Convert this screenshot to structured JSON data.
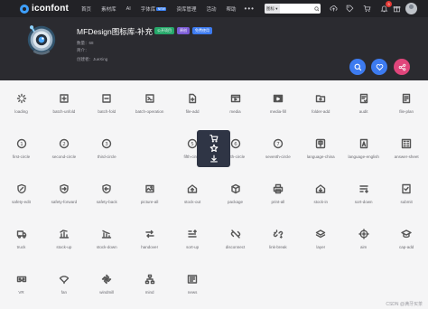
{
  "topnav": {
    "logo_text": "iconfont",
    "menu": [
      {
        "label": "首页",
        "badge": ""
      },
      {
        "label": "素材库",
        "badge": ""
      },
      {
        "label": "AI",
        "badge": ""
      },
      {
        "label": "字体库",
        "badge": "NEW"
      },
      {
        "label": "资库管理",
        "badge": ""
      },
      {
        "label": "活动",
        "badge": ""
      },
      {
        "label": "帮助",
        "badge": ""
      }
    ],
    "more_label": "•••",
    "search": {
      "type_label": "图标 ▾",
      "placeholder": ""
    },
    "cart_count": "3"
  },
  "header": {
    "title": "MFDesign图标库-补充",
    "tags": [
      "公开项目",
      "原创",
      "免费使用"
    ],
    "meta": [
      {
        "label": "数量：",
        "value": "68"
      },
      {
        "label": "简介：",
        "value": ""
      },
      {
        "label": "创建者：",
        "value": "JueXing"
      }
    ]
  },
  "icons": [
    {
      "name": "loading",
      "icon": "loading-icon"
    },
    {
      "name": "batch-unfold",
      "icon": "batch-unfold-icon"
    },
    {
      "name": "batch-fold",
      "icon": "batch-fold-icon"
    },
    {
      "name": "batch-operation",
      "icon": "batch-operation-icon"
    },
    {
      "name": "file-add",
      "icon": "file-add-icon"
    },
    {
      "name": "media",
      "icon": "media-icon"
    },
    {
      "name": "media-fill",
      "icon": "media-fill-icon"
    },
    {
      "name": "folder-add",
      "icon": "folder-add-icon"
    },
    {
      "name": "audit",
      "icon": "audit-icon"
    },
    {
      "name": "file-plan",
      "icon": "file-plan-icon"
    },
    {
      "name": "first-circle",
      "icon": "first-circle-icon"
    },
    {
      "name": "second-circle",
      "icon": "second-circle-icon"
    },
    {
      "name": "third-circle",
      "icon": "third-circle-icon"
    },
    {
      "name": "",
      "icon": "hover-card"
    },
    {
      "name": "fifth-circle",
      "icon": "fifth-circle-icon"
    },
    {
      "name": "sixth-circle",
      "icon": "sixth-circle-icon"
    },
    {
      "name": "seventh-circle",
      "icon": "seventh-circle-icon"
    },
    {
      "name": "language-china",
      "icon": "language-china-icon"
    },
    {
      "name": "language-english",
      "icon": "language-english-icon"
    },
    {
      "name": "answer-sheet",
      "icon": "answer-sheet-icon"
    },
    {
      "name": "safety-edit",
      "icon": "safety-edit-icon"
    },
    {
      "name": "safety-forward",
      "icon": "safety-forward-icon"
    },
    {
      "name": "safety-back",
      "icon": "safety-back-icon"
    },
    {
      "name": "picture-all",
      "icon": "picture-all-icon"
    },
    {
      "name": "stock-out",
      "icon": "stock-out-icon"
    },
    {
      "name": "package",
      "icon": "package-icon"
    },
    {
      "name": "print-all",
      "icon": "print-all-icon"
    },
    {
      "name": "stock-in",
      "icon": "stock-in-icon"
    },
    {
      "name": "sort-down",
      "icon": "sort-down-icon"
    },
    {
      "name": "submit",
      "icon": "submit-icon"
    },
    {
      "name": "truck",
      "icon": "truck-icon"
    },
    {
      "name": "stock-up",
      "icon": "stock-up-icon"
    },
    {
      "name": "stock-down",
      "icon": "stock-down-icon"
    },
    {
      "name": "handover",
      "icon": "handover-icon"
    },
    {
      "name": "sort-up",
      "icon": "sort-up-icon"
    },
    {
      "name": "disconnect",
      "icon": "disconnect-icon"
    },
    {
      "name": "link-break",
      "icon": "link-break-icon"
    },
    {
      "name": "layer",
      "icon": "layer-icon"
    },
    {
      "name": "aim",
      "icon": "aim-icon"
    },
    {
      "name": "cap-add",
      "icon": "cap-add-icon"
    },
    {
      "name": "VR",
      "icon": "vr-icon"
    },
    {
      "name": "fan",
      "icon": "fan-icon"
    },
    {
      "name": "windmill",
      "icon": "windmill-icon"
    },
    {
      "name": "mind",
      "icon": "mind-icon"
    },
    {
      "name": "news",
      "icon": "news-icon"
    }
  ],
  "hover_actions": [
    "cart-icon",
    "star-icon",
    "download-icon"
  ],
  "watermark": "CSDN @满牙买茶",
  "colors": {
    "nav_bg": "#222226",
    "header_bg": "#2b2b30",
    "accent_blue": "#3d7bf0",
    "accent_pink": "#e0457b",
    "page_bg": "#f5f5f6",
    "hover_card": "#2f3545"
  }
}
